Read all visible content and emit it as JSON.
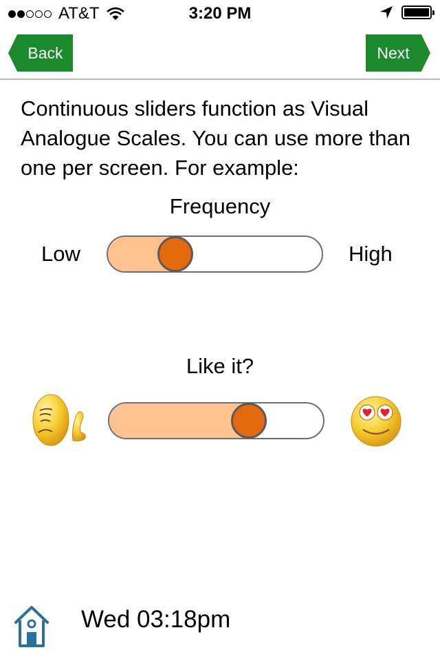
{
  "status_bar": {
    "carrier": "AT&T",
    "time": "3:20 PM",
    "signal_dots_filled": 2,
    "signal_dots_total": 5,
    "battery_level": 1.0
  },
  "nav": {
    "back_label": "Back",
    "next_label": "Next",
    "accent_color": "#1b8a2c"
  },
  "intro_text": "Continuous sliders function as Visual Analogue Scales. You can use more than one per screen. For example:",
  "sliders": [
    {
      "title": "Frequency",
      "min_label": "Low",
      "max_label": "High",
      "value": 0.28
    },
    {
      "title": "Like it?",
      "min_icon": "sad-face-emoji-icon",
      "max_icon": "heart-eyes-emoji-icon",
      "value": 0.68
    }
  ],
  "colors": {
    "slider_fill": "#fcc28f",
    "slider_thumb": "#e4680e",
    "home_icon": "#2a6f9e"
  },
  "footer": {
    "datetime": "Wed 03:18pm",
    "home_icon": "home-icon"
  }
}
